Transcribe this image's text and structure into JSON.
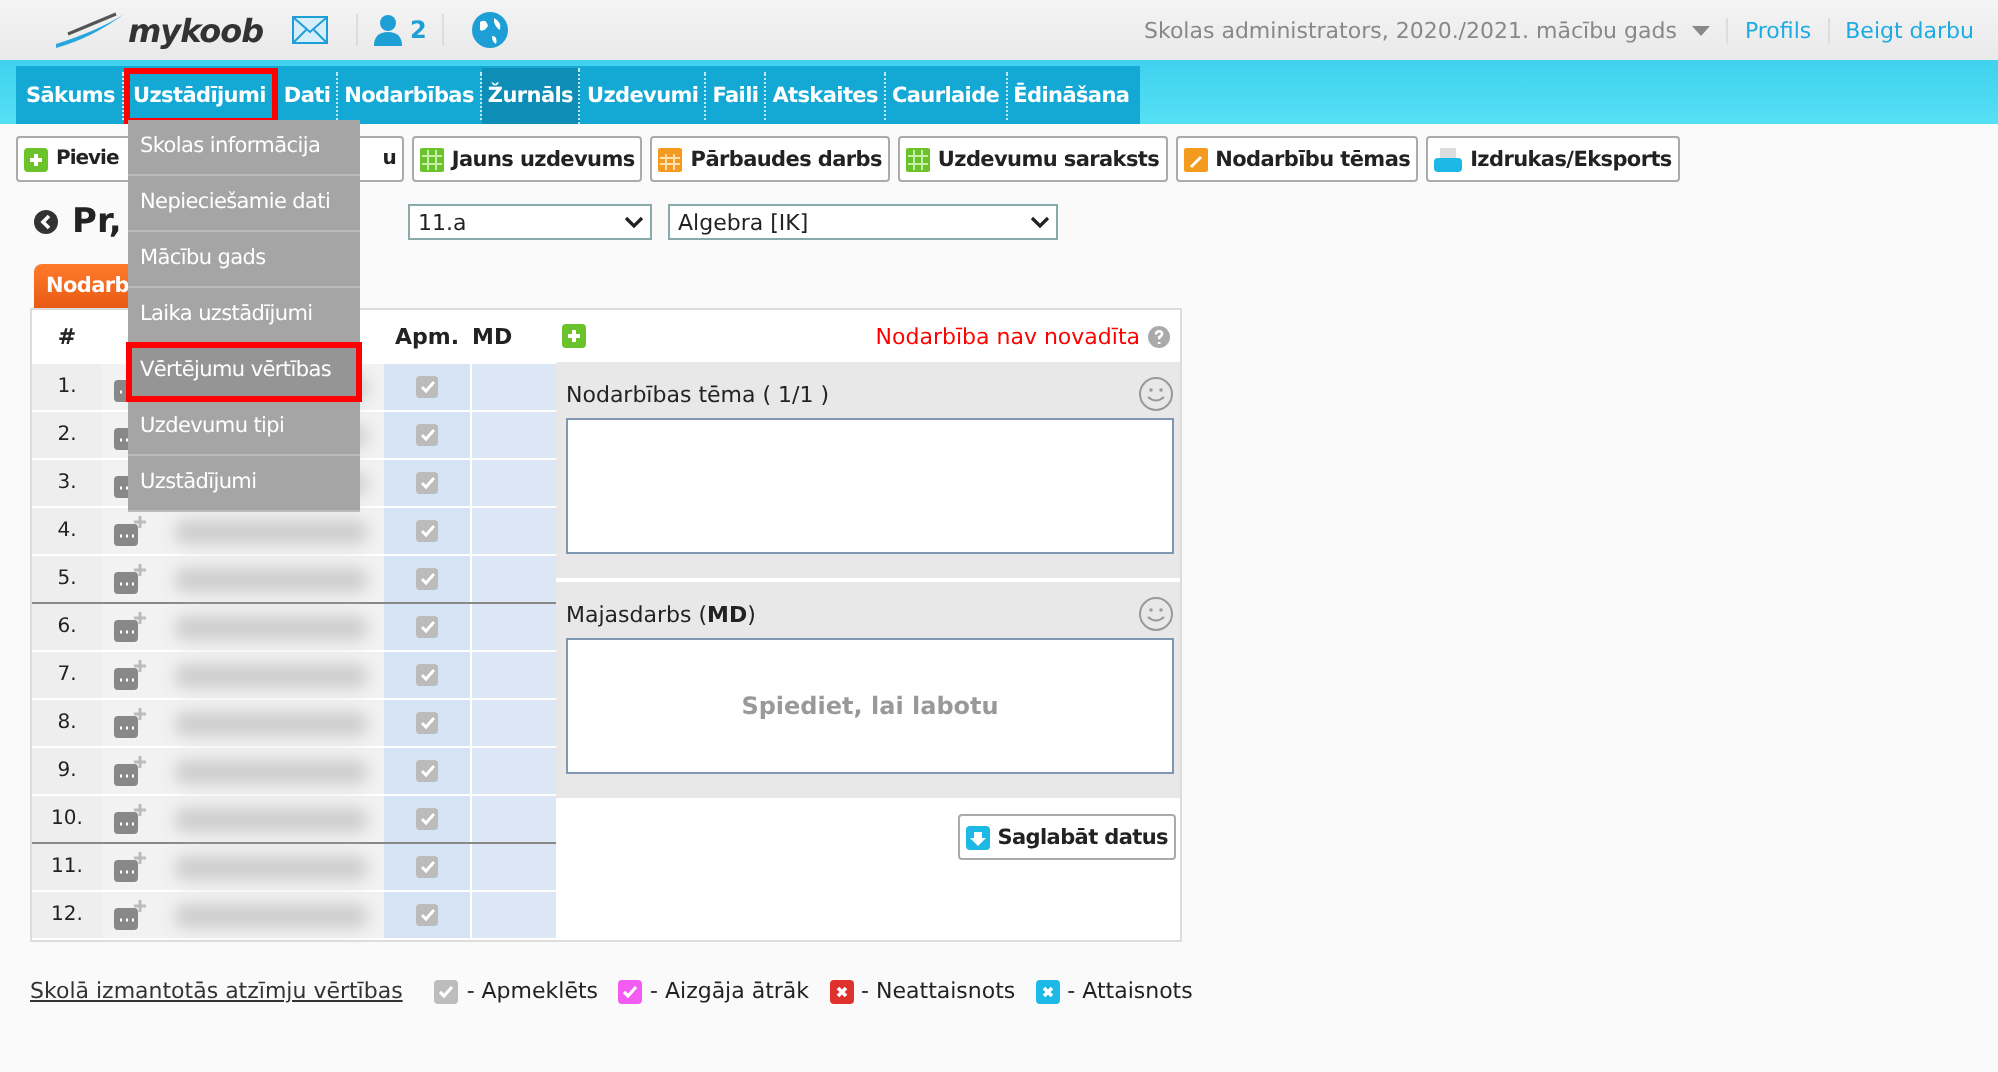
{
  "header": {
    "logo": "mykoob",
    "people_count": "2",
    "account": "Skolas administrators, 2020./2021. mācību gads",
    "links": [
      "Profils",
      "Beigt darbu"
    ]
  },
  "nav": [
    {
      "label": "Sākums",
      "selected": false,
      "highlighted": false
    },
    {
      "label": "Uzstādījumi",
      "selected": false,
      "highlighted": true
    },
    {
      "label": "Dati",
      "selected": false,
      "highlighted": false
    },
    {
      "label": "Nodarbības",
      "selected": false,
      "highlighted": false
    },
    {
      "label": "Žurnāls",
      "selected": true,
      "highlighted": false
    },
    {
      "label": "Uzdevumi",
      "selected": false,
      "highlighted": false
    },
    {
      "label": "Faili",
      "selected": false,
      "highlighted": false
    },
    {
      "label": "Atskaites",
      "selected": false,
      "highlighted": false
    },
    {
      "label": "Caurlaide",
      "selected": false,
      "highlighted": false
    },
    {
      "label": "Ēdināšana",
      "selected": false,
      "highlighted": false
    }
  ],
  "menu": [
    {
      "label": "Skolas informācija",
      "highlighted": false
    },
    {
      "label": "Nepieciešamie dati",
      "highlighted": false
    },
    {
      "label": "Mācību gads",
      "highlighted": false
    },
    {
      "label": "Laika uzstādījumi",
      "highlighted": false
    },
    {
      "label": "Vērtējumu vērtības",
      "highlighted": true
    },
    {
      "label": "Uzdevumu tipi",
      "highlighted": false
    },
    {
      "label": "Uzstādījumi",
      "highlighted": false
    }
  ],
  "toolbar": [
    {
      "kind": "add",
      "label": "Pievie",
      "label_end": "u"
    },
    {
      "kind": "task",
      "label": "Jauns uzdevums"
    },
    {
      "kind": "test",
      "label": "Pārbaudes darbs"
    },
    {
      "kind": "task",
      "label": "Uzdevumu saraksts"
    },
    {
      "kind": "topic",
      "label": "Nodarbību tēmas"
    },
    {
      "kind": "print",
      "label": "Izdrukas/Eksports"
    }
  ],
  "page_title": "Pr,",
  "selects": [
    {
      "value": "11.a"
    },
    {
      "value": "Algebra [IK]"
    }
  ],
  "tab": {
    "label": "Nodarb",
    "selected": true
  },
  "table": {
    "columns": [
      "#",
      "Apm.",
      "MD"
    ],
    "rows": [
      {
        "number": "1.",
        "attended": true
      },
      {
        "number": "2.",
        "attended": true
      },
      {
        "number": "3.",
        "attended": true
      },
      {
        "number": "4.",
        "attended": true
      },
      {
        "number": "5.",
        "attended": true
      },
      {
        "number": "6.",
        "attended": true
      },
      {
        "number": "7.",
        "attended": true
      },
      {
        "number": "8.",
        "attended": true
      },
      {
        "number": "9.",
        "attended": true
      },
      {
        "number": "10.",
        "attended": true
      },
      {
        "number": "11.",
        "attended": true
      },
      {
        "number": "12.",
        "attended": true
      }
    ]
  },
  "panel": {
    "status": "Nodarbība nav novadīta",
    "topic": {
      "label": "Nodarbības tēma ( 1/1 )"
    },
    "homework": {
      "label": "Majasdarbs (**MD**)",
      "placeholder": "Spiediet, lai labotu"
    },
    "save": "Saglabāt datus"
  },
  "legend": {
    "link": "Skolā izmantotās atzīmju vērtības",
    "items": [
      {
        "label": "- Apmeklēts",
        "color": "#bdbdbd",
        "kind": "present"
      },
      {
        "label": "- Aizgāja ātrāk",
        "color": "#f25cf0",
        "kind": "present"
      },
      {
        "label": "- Neattaisnots",
        "color": "#e0322d",
        "kind": "absent"
      },
      {
        "label": "- Attaisnots",
        "color": "#1cb8e6",
        "kind": "absent"
      }
    ]
  }
}
